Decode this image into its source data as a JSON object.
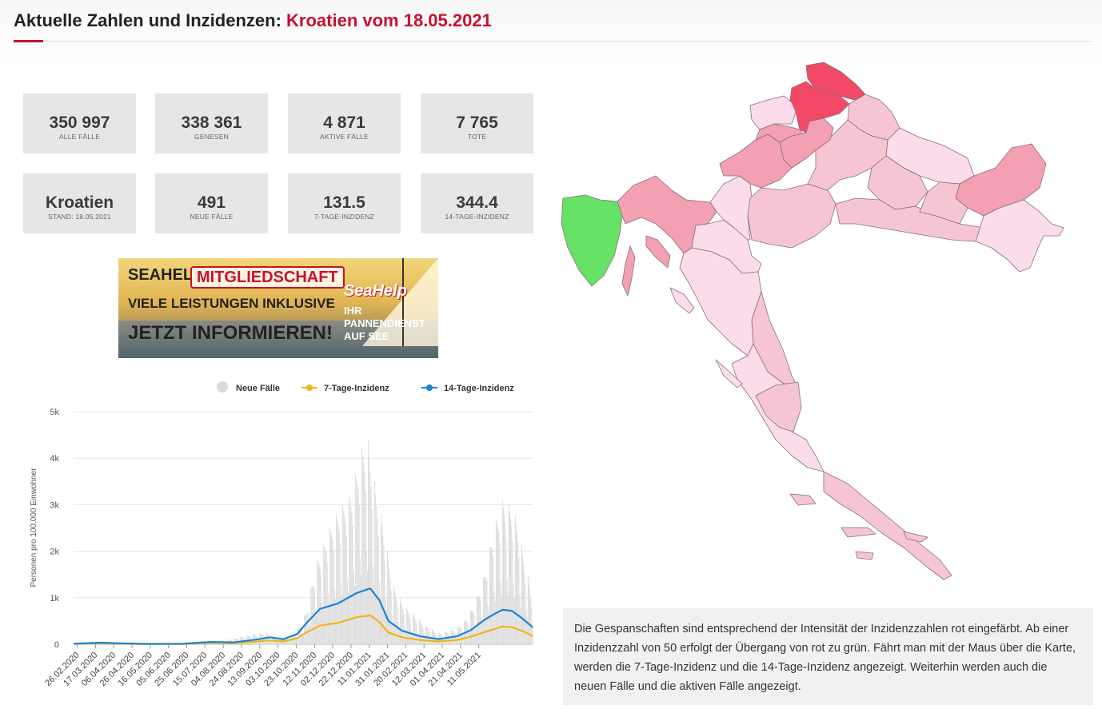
{
  "header": {
    "title_prefix": "Aktuelle Zahlen und Inzidenzen: ",
    "title_highlight": "Kroatien vom 18.05.2021"
  },
  "stats": [
    {
      "value": "350 997",
      "label": "Alle Fälle"
    },
    {
      "value": "338 361",
      "label": "Genesen"
    },
    {
      "value": "4 871",
      "label": "Aktive Fälle"
    },
    {
      "value": "7 765",
      "label": "Tote"
    },
    {
      "value": "Kroatien",
      "label": "Stand: 18.05.2021"
    },
    {
      "value": "491",
      "label": "Neue Fälle"
    },
    {
      "value": "131.5",
      "label": "7-Tage-Inzidenz"
    },
    {
      "value": "344.4",
      "label": "14-Tage-Inzidenz"
    }
  ],
  "ad": {
    "line1_a": "SEAHELP",
    "line1_b": "MITGLIEDSCHAFT",
    "line2": "VIELE LEISTUNGEN INKLUSIVE",
    "line3": "JETZT INFORMIEREN!",
    "brand": "SeaHelp",
    "brand_sub": "IHR PANNENDIENST AUF SEE"
  },
  "chart_data": {
    "type": "bar",
    "ylabel": "Personen pro 100.000 Einwohner",
    "ylim": [
      0,
      5000
    ],
    "y_ticks": [
      "0",
      "1k",
      "2k",
      "3k",
      "4k",
      "5k"
    ],
    "x_ticks": [
      "26.02.2020",
      "17.03.2020",
      "06.04.2020",
      "26.04.2020",
      "16.05.2020",
      "05.06.2020",
      "25.06.2020",
      "15.07.2020",
      "04.08.2020",
      "24.08.2020",
      "13.09.2020",
      "03.10.2020",
      "23.10.2020",
      "12.11.2020",
      "02.12.2020",
      "22.12.2020",
      "11.01.2021",
      "31.01.2021",
      "20.02.2021",
      "12.03.2021",
      "01.04.2021",
      "21.04.2021",
      "11.05.2021"
    ],
    "legend_position": "top-right",
    "grid": true,
    "series": [
      {
        "name": "Neue Fälle",
        "kind": "bar",
        "color": "#dadada",
        "points": [
          [
            0,
            0
          ],
          [
            20,
            5
          ],
          [
            40,
            40
          ],
          [
            60,
            20
          ],
          [
            80,
            5
          ],
          [
            100,
            3
          ],
          [
            120,
            5
          ],
          [
            140,
            40
          ],
          [
            160,
            80
          ],
          [
            175,
            120
          ],
          [
            190,
            200
          ],
          [
            210,
            260
          ],
          [
            220,
            150
          ],
          [
            235,
            140
          ],
          [
            245,
            300
          ],
          [
            255,
            700
          ],
          [
            265,
            1700
          ],
          [
            275,
            2200
          ],
          [
            285,
            2700
          ],
          [
            295,
            3000
          ],
          [
            305,
            3300
          ],
          [
            315,
            4200
          ],
          [
            322,
            4500
          ],
          [
            330,
            3500
          ],
          [
            340,
            2500
          ],
          [
            350,
            1300
          ],
          [
            360,
            900
          ],
          [
            370,
            700
          ],
          [
            380,
            500
          ],
          [
            390,
            350
          ],
          [
            400,
            250
          ],
          [
            410,
            280
          ],
          [
            420,
            350
          ],
          [
            430,
            550
          ],
          [
            440,
            900
          ],
          [
            450,
            1500
          ],
          [
            460,
            2500
          ],
          [
            470,
            3100
          ],
          [
            480,
            3000
          ],
          [
            487,
            2600
          ],
          [
            493,
            1900
          ],
          [
            500,
            1300
          ],
          [
            503,
            900
          ]
        ]
      },
      {
        "name": "7-Tage-Inzidenz",
        "kind": "line",
        "color": "#f0b51a",
        "points": [
          [
            0,
            5
          ],
          [
            30,
            18
          ],
          [
            50,
            10
          ],
          [
            80,
            4
          ],
          [
            120,
            6
          ],
          [
            150,
            30
          ],
          [
            175,
            20
          ],
          [
            200,
            55
          ],
          [
            215,
            85
          ],
          [
            230,
            60
          ],
          [
            245,
            130
          ],
          [
            255,
            250
          ],
          [
            270,
            400
          ],
          [
            290,
            460
          ],
          [
            310,
            580
          ],
          [
            325,
            620
          ],
          [
            335,
            480
          ],
          [
            345,
            250
          ],
          [
            360,
            150
          ],
          [
            380,
            90
          ],
          [
            400,
            60
          ],
          [
            420,
            90
          ],
          [
            435,
            160
          ],
          [
            450,
            260
          ],
          [
            460,
            320
          ],
          [
            470,
            380
          ],
          [
            480,
            370
          ],
          [
            490,
            300
          ],
          [
            500,
            210
          ],
          [
            503,
            170
          ]
        ]
      },
      {
        "name": "14-Tage-Inzidenz",
        "kind": "line",
        "color": "#1b82d6",
        "points": [
          [
            0,
            10
          ],
          [
            30,
            35
          ],
          [
            50,
            20
          ],
          [
            80,
            8
          ],
          [
            120,
            10
          ],
          [
            150,
            50
          ],
          [
            175,
            40
          ],
          [
            200,
            100
          ],
          [
            215,
            150
          ],
          [
            230,
            110
          ],
          [
            245,
            220
          ],
          [
            255,
            450
          ],
          [
            270,
            760
          ],
          [
            290,
            880
          ],
          [
            310,
            1100
          ],
          [
            325,
            1200
          ],
          [
            335,
            950
          ],
          [
            345,
            500
          ],
          [
            360,
            290
          ],
          [
            380,
            170
          ],
          [
            400,
            110
          ],
          [
            420,
            170
          ],
          [
            435,
            300
          ],
          [
            450,
            520
          ],
          [
            460,
            640
          ],
          [
            470,
            740
          ],
          [
            480,
            720
          ],
          [
            490,
            580
          ],
          [
            500,
            420
          ],
          [
            503,
            360
          ]
        ]
      }
    ]
  },
  "map": {
    "colors": {
      "strong": "#f24a66",
      "high": "#f3a0b3",
      "mid": "#f6c5d4",
      "low": "#fadcea",
      "green": "#66e266"
    }
  },
  "info": {
    "text": "Die Gespanschaften sind entsprechend der Intensität der Inzidenzzahlen rot eingefärbt. Ab einer Inzidenzzahl von 50 erfolgt der Übergang von rot zu grün. Fährt man mit der Maus über die Karte, werden die 7-Tage-Inzidenz und die 14-Tage-Inzidenz angezeigt. Weiterhin werden auch die neuen Fälle und die aktiven Fälle angezeigt."
  }
}
